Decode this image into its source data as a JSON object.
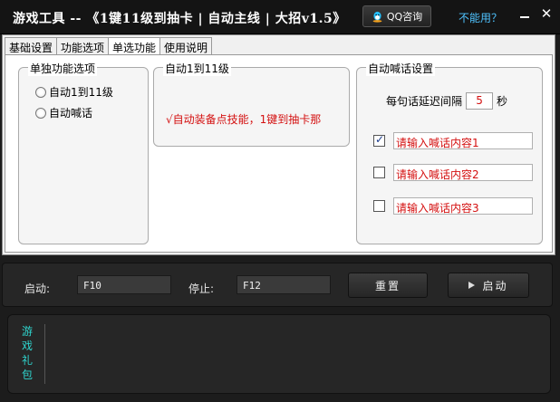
{
  "titlebar": {
    "title": "游戏工具 -- 《1键11级到抽卡 | 自动主线 | 大招v1.5》",
    "qq_label": "QQ咨询",
    "help_label": "不能用？"
  },
  "tabs": [
    {
      "label": "基础设置"
    },
    {
      "label": "功能选项"
    },
    {
      "label": "单选功能"
    },
    {
      "label": "使用说明"
    }
  ],
  "single_options": {
    "title": "单独功能选项",
    "options": [
      {
        "label": "自动1到11级"
      },
      {
        "label": "自动喊话"
      }
    ]
  },
  "auto_level": {
    "title": "自动1到11级",
    "note": "√自动装备点技能，1键到抽卡那"
  },
  "auto_shout": {
    "title": "自动喊话设置",
    "delay_prefix": "每句话延迟间隔",
    "delay_value": "5",
    "delay_unit": "秒",
    "messages": [
      {
        "text": "请输入喊话内容1",
        "checked": true
      },
      {
        "text": "请输入喊话内容2",
        "checked": false
      },
      {
        "text": "请输入喊话内容3",
        "checked": false
      }
    ]
  },
  "controls": {
    "start_label": "启动:",
    "start_key": "F10",
    "stop_label": "停止:",
    "stop_key": "F12",
    "reset_button": "重置",
    "start_button": "启动"
  },
  "gift": {
    "label": "游戏礼包"
  }
}
